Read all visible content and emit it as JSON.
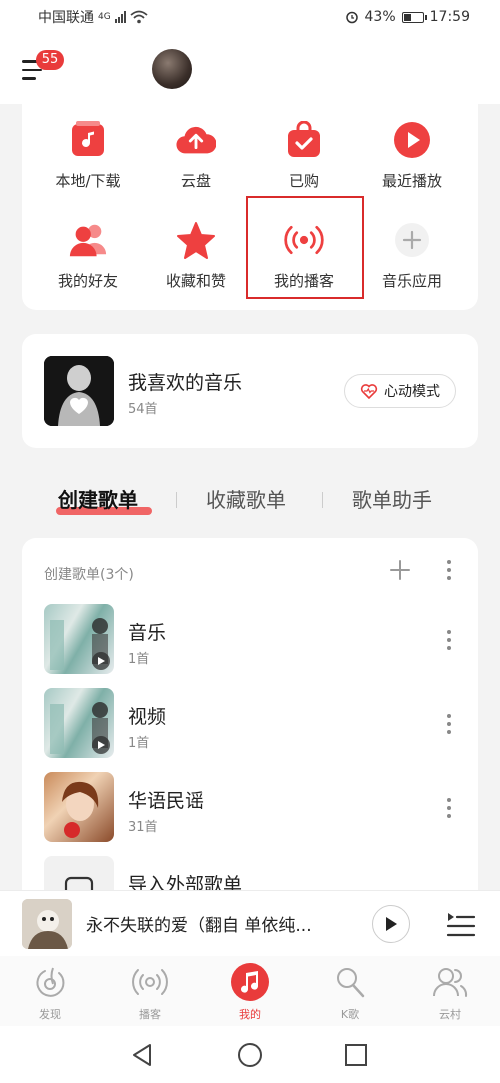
{
  "status_bar": {
    "carrier": "中国联通",
    "network": "4G",
    "battery": "43%",
    "battery_level": 0.43,
    "time": "17:59"
  },
  "header": {
    "notification_count": "55"
  },
  "quick_grid": [
    {
      "label": "本地/下载",
      "icon": "music-file-icon"
    },
    {
      "label": "云盘",
      "icon": "cloud-upload-icon"
    },
    {
      "label": "已购",
      "icon": "shopping-bag-icon"
    },
    {
      "label": "最近播放",
      "icon": "play-circle-icon"
    },
    {
      "label": "我的好友",
      "icon": "friends-icon"
    },
    {
      "label": "收藏和赞",
      "icon": "star-icon"
    },
    {
      "label": "我的播客",
      "icon": "podcast-broadcast-icon"
    },
    {
      "label": "音乐应用",
      "icon": "plus-icon"
    }
  ],
  "liked_music": {
    "title": "我喜欢的音乐",
    "count": "54首",
    "heart_mode_label": "心动模式"
  },
  "tabs": [
    {
      "label": "创建歌单",
      "active": true
    },
    {
      "label": "收藏歌单",
      "active": false
    },
    {
      "label": "歌单助手",
      "active": false
    }
  ],
  "playlists": {
    "header": "创建歌单(3个)",
    "items": [
      {
        "title": "音乐",
        "count": "1首"
      },
      {
        "title": "视频",
        "count": "1首"
      },
      {
        "title": "华语民谣",
        "count": "31首"
      },
      {
        "title": "导入外部歌单",
        "count": ""
      }
    ]
  },
  "player": {
    "title": "永不失联的爱（翻自 单依纯..."
  },
  "bottom_nav": [
    {
      "label": "发现",
      "icon": "discover-icon",
      "active": false
    },
    {
      "label": "播客",
      "icon": "podcast-icon",
      "active": false
    },
    {
      "label": "我的",
      "icon": "my-music-icon",
      "active": true
    },
    {
      "label": "K歌",
      "icon": "karaoke-mic-icon",
      "active": false
    },
    {
      "label": "云村",
      "icon": "community-icon",
      "active": false
    }
  ],
  "colors": {
    "accent": "#e93b3b",
    "highlight_box": "#d92b2b"
  }
}
